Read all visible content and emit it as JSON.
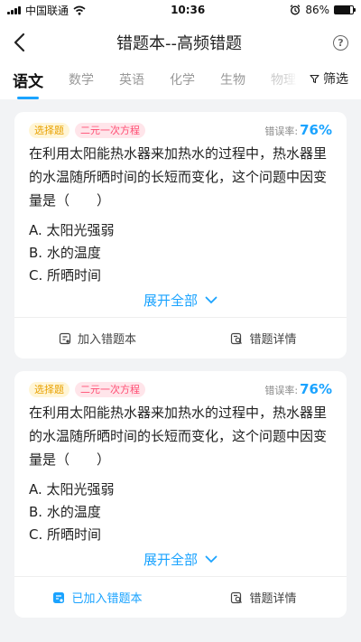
{
  "status": {
    "carrier": "中国联通",
    "time": "10:36",
    "battery_text": "86%",
    "battery_level": 0.86
  },
  "nav": {
    "title": "错题本--高频错题",
    "back_icon": "back-chevron-icon",
    "help_icon": "help-circle-icon",
    "help_glyph": "?"
  },
  "tabs": [
    {
      "label": "语文",
      "active": true
    },
    {
      "label": "数学"
    },
    {
      "label": "英语"
    },
    {
      "label": "化学"
    },
    {
      "label": "生物"
    },
    {
      "label": "物理"
    }
  ],
  "filter": {
    "label": "筛选"
  },
  "colors": {
    "accent": "#1aa3ff",
    "tag_type_bg": "#fff5d6",
    "tag_type_fg": "#e8a100",
    "tag_topic_bg": "#ffe5ea",
    "tag_topic_fg": "#ff4d73"
  },
  "cards": [
    {
      "type_tag": "选择题",
      "topic_tag": "二元一次方程",
      "error_label": "错误率:",
      "error_rate": "76%",
      "question": "在利用太阳能热水器来加热水的过程中，热水器里的水温随所晒时间的长短而变化，这个问题中因变量是（　　）",
      "options": [
        "A. 太阳光强弱",
        "B. 水的温度",
        "C. 所晒时间"
      ],
      "expand_label": "展开全部",
      "add_label": "加入错题本",
      "added": false,
      "detail_label": "错题详情"
    },
    {
      "type_tag": "选择题",
      "topic_tag": "二元一次方程",
      "error_label": "错误率:",
      "error_rate": "76%",
      "question": "在利用太阳能热水器来加热水的过程中，热水器里的水温随所晒时间的长短而变化，这个问题中因变量是（　　）",
      "options": [
        "A. 太阳光强弱",
        "B. 水的温度",
        "C. 所晒时间"
      ],
      "expand_label": "展开全部",
      "add_label": "已加入错题本",
      "added": true,
      "detail_label": "错题详情"
    }
  ]
}
